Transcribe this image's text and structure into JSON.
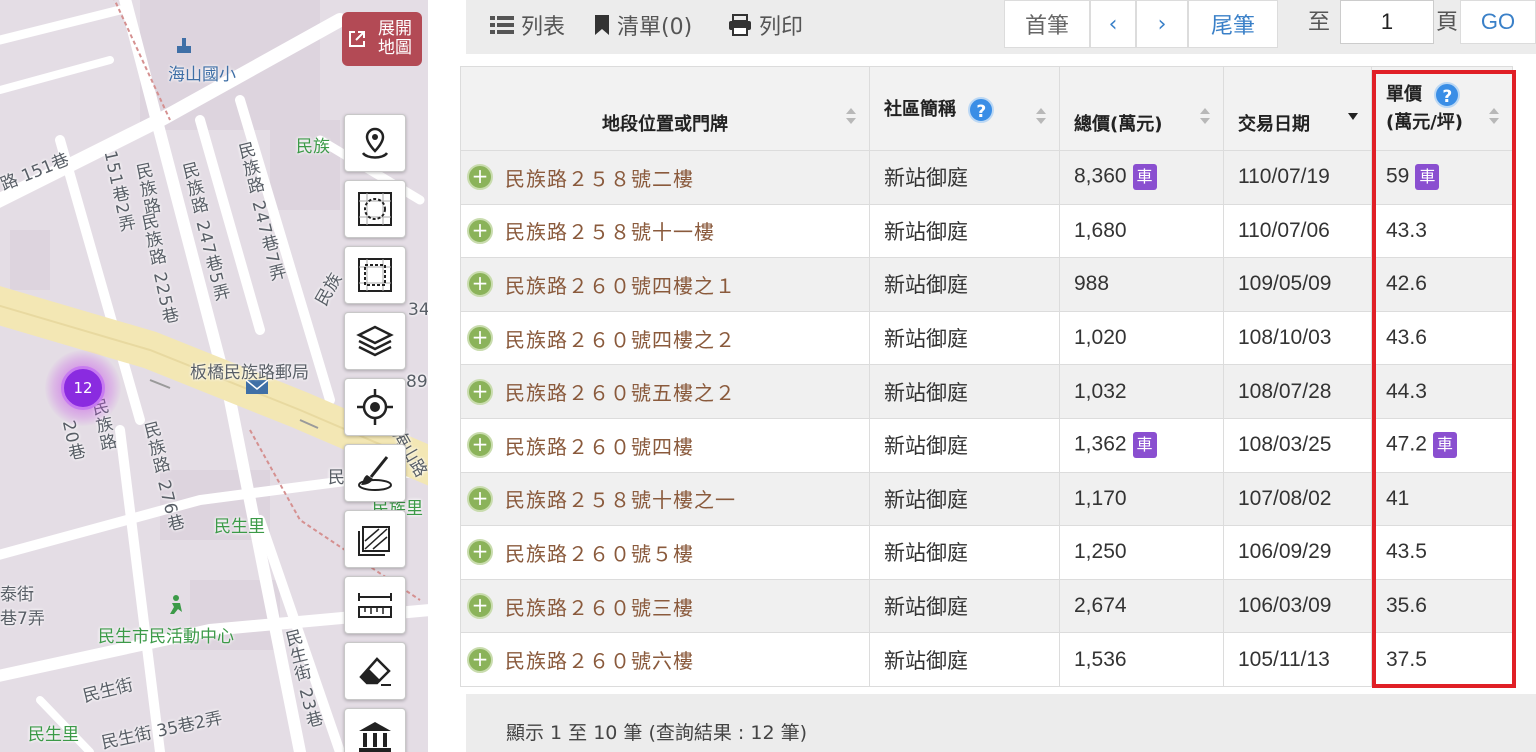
{
  "map": {
    "expand_label": "展開地圖",
    "cluster_count": "12",
    "labels": {
      "haishan_school": "海山國小",
      "minzu_road_top": "民族",
      "lane_151": "路 151巷",
      "alley_151_2": "151巷2弄",
      "minzu_road_a": "民族路",
      "minzu_225": "民族路 225巷",
      "minzu_247_5": "民族路 247巷5弄",
      "minzu_247_7": "民族路 247巷7弄",
      "minzu_road_b": "民族",
      "post_office": "板橋民族路郵局",
      "minzu_road_c": "民族路",
      "minzu_276": "民族路 276巷",
      "lane_20": "20巷",
      "minsheng_li": "民生里",
      "taijie": "泰街",
      "lane_7": "巷7弄",
      "community_center": "民生市民活動中心",
      "minsheng_street": "民生街",
      "minsheng_35_2": "民生街 35巷2弄",
      "minsheng_23": "民生街 23巷",
      "minsheng_li_bottom": "民生里",
      "haishan_road": "海山路",
      "minzu_right": "民族里",
      "num_34": "34",
      "num_89": "89",
      "min_right": "民"
    }
  },
  "toolbar": {
    "list_label": "列表",
    "bookmark_label": "清單(0)",
    "print_label": "列印",
    "first_label": "首筆",
    "prev_label": "‹",
    "next_label": "›",
    "last_label": "尾筆",
    "to_label": "至",
    "page_value": "1",
    "page_suffix": "頁",
    "go_label": "GO"
  },
  "table": {
    "headers": {
      "address": "地段位置或門牌",
      "community": "社區簡稱",
      "total_price": "總價(萬元)",
      "trade_date": "交易日期",
      "unit_price_line1": "單價",
      "unit_price_line2": "(萬元/坪)"
    },
    "car_badge": "車",
    "rows": [
      {
        "address": "民族路２５８號二樓",
        "community": "新站御庭",
        "total": "8,360",
        "total_car": true,
        "date": "110/07/19",
        "unit": "59",
        "unit_car": true
      },
      {
        "address": "民族路２５８號十一樓",
        "community": "新站御庭",
        "total": "1,680",
        "total_car": false,
        "date": "110/07/06",
        "unit": "43.3",
        "unit_car": false
      },
      {
        "address": "民族路２６０號四樓之１",
        "community": "新站御庭",
        "total": "988",
        "total_car": false,
        "date": "109/05/09",
        "unit": "42.6",
        "unit_car": false
      },
      {
        "address": "民族路２６０號四樓之２",
        "community": "新站御庭",
        "total": "1,020",
        "total_car": false,
        "date": "108/10/03",
        "unit": "43.6",
        "unit_car": false
      },
      {
        "address": "民族路２６０號五樓之２",
        "community": "新站御庭",
        "total": "1,032",
        "total_car": false,
        "date": "108/07/28",
        "unit": "44.3",
        "unit_car": false
      },
      {
        "address": "民族路２６０號四樓",
        "community": "新站御庭",
        "total": "1,362",
        "total_car": true,
        "date": "108/03/25",
        "unit": "47.2",
        "unit_car": true
      },
      {
        "address": "民族路２５８號十樓之一",
        "community": "新站御庭",
        "total": "1,170",
        "total_car": false,
        "date": "107/08/02",
        "unit": "41",
        "unit_car": false
      },
      {
        "address": "民族路２６０號５樓",
        "community": "新站御庭",
        "total": "1,250",
        "total_car": false,
        "date": "106/09/29",
        "unit": "43.5",
        "unit_car": false
      },
      {
        "address": "民族路２６０號三樓",
        "community": "新站御庭",
        "total": "2,674",
        "total_car": false,
        "date": "106/03/09",
        "unit": "35.6",
        "unit_car": false
      },
      {
        "address": "民族路２６０號六樓",
        "community": "新站御庭",
        "total": "1,536",
        "total_car": false,
        "date": "105/11/13",
        "unit": "37.5",
        "unit_car": false
      }
    ]
  },
  "footer": {
    "summary": "顯示 1 至 10 筆 (查詢結果 : 12 筆)"
  },
  "colors": {
    "highlight_border": "#e01f26",
    "car_badge": "#8a4fd0",
    "address_link": "#8a5a3c",
    "plus_icon": "#8bb35a",
    "pager_text": "#3a80c8",
    "expand_button": "#b34a55",
    "cluster": "#8a2be0"
  }
}
